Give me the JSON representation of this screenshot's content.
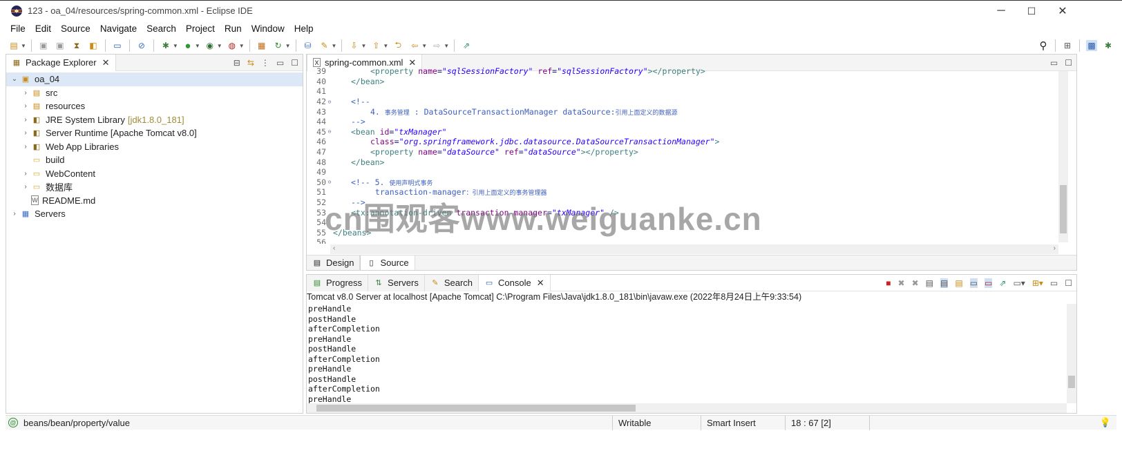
{
  "window": {
    "title": "123 - oa_04/resources/spring-common.xml - Eclipse IDE",
    "minimize": "─",
    "maximize": "☐",
    "close": "✕"
  },
  "menu": [
    "File",
    "Edit",
    "Source",
    "Navigate",
    "Search",
    "Project",
    "Run",
    "Window",
    "Help"
  ],
  "package_explorer": {
    "tab_label": "Package Explorer",
    "tree": [
      {
        "label": "oa_04",
        "suffix": "",
        "level": 0,
        "expanded": true,
        "icon": "project-icon",
        "selected": true
      },
      {
        "label": "src",
        "suffix": "",
        "level": 1,
        "expanded": false,
        "icon": "source-folder-icon"
      },
      {
        "label": "resources",
        "suffix": "",
        "level": 1,
        "expanded": false,
        "icon": "source-folder-icon"
      },
      {
        "label": "JRE System Library",
        "suffix": "[jdk1.8.0_181]",
        "level": 1,
        "expanded": false,
        "icon": "library-icon"
      },
      {
        "label": "Server Runtime [Apache Tomcat v8.0]",
        "suffix": "",
        "level": 1,
        "expanded": false,
        "icon": "library-icon"
      },
      {
        "label": "Web App Libraries",
        "suffix": "",
        "level": 1,
        "expanded": false,
        "icon": "library-icon"
      },
      {
        "label": "build",
        "suffix": "",
        "level": 1,
        "expanded": null,
        "icon": "folder-icon"
      },
      {
        "label": "WebContent",
        "suffix": "",
        "level": 1,
        "expanded": false,
        "icon": "folder-icon"
      },
      {
        "label": "数据库",
        "suffix": "",
        "level": 1,
        "expanded": false,
        "icon": "folder-icon"
      },
      {
        "label": "README.md",
        "suffix": "",
        "level": 1,
        "expanded": null,
        "icon": "file-icon"
      },
      {
        "label": "Servers",
        "suffix": "",
        "level": 0,
        "expanded": false,
        "icon": "servers-project-icon"
      }
    ]
  },
  "editor": {
    "tab_label": "spring-common.xml",
    "bottom_tabs": [
      "Design",
      "Source"
    ],
    "lines": [
      {
        "n": "39",
        "fold": "",
        "html": "<span class='tag'>&lt;property</span> <span class='attr'>name</span>=<span class='val'>\"sqlSessionFactory\"</span> <span class='attr'>ref</span>=<span class='val'>\"sqlSessionFactory\"</span><span class='tag'>&gt;&lt;/property&gt;</span>",
        "indent": 2
      },
      {
        "n": "40",
        "fold": "",
        "html": "<span class='tag'>&lt;/bean&gt;</span>",
        "indent": 1
      },
      {
        "n": "41",
        "fold": "",
        "html": "",
        "indent": 1
      },
      {
        "n": "42",
        "fold": "⊖",
        "html": "<span class='cmt'>&lt;!--</span>",
        "indent": 1
      },
      {
        "n": "43",
        "fold": "",
        "html": "<span class='cmt'>4. <span class='cjk'>事务管理</span> : DataSourceTransactionManager dataSource:<span class='cjk'>引用上面定义的数据源</span></span>",
        "indent": 2
      },
      {
        "n": "44",
        "fold": "",
        "html": "<span class='cmt'>--&gt;</span>",
        "indent": 1
      },
      {
        "n": "45",
        "fold": "⊖",
        "html": "<span class='tag'>&lt;bean</span> <span class='attr'>id</span>=<span class='val'>\"txManager\"</span>",
        "indent": 1
      },
      {
        "n": "46",
        "fold": "",
        "html": "<span class='attr'>class</span>=<span class='val'>\"org.springframework.jdbc.datasource.DataSourceTransactionManager\"</span><span class='tag'>&gt;</span>",
        "indent": 2
      },
      {
        "n": "47",
        "fold": "",
        "html": "<span class='tag'>&lt;property</span> <span class='attr'>name</span>=<span class='val'>\"dataSource\"</span> <span class='attr'>ref</span>=<span class='val'>\"dataSource\"</span><span class='tag'>&gt;&lt;/property&gt;</span>",
        "indent": 2
      },
      {
        "n": "48",
        "fold": "",
        "html": "<span class='tag'>&lt;/bean&gt;</span>",
        "indent": 1
      },
      {
        "n": "49",
        "fold": "",
        "html": "",
        "indent": 1
      },
      {
        "n": "50",
        "fold": "⊖",
        "html": "<span class='cmt'>&lt;!-- 5. <span class='cjk'>使用声明式事务</span></span>",
        "indent": 1
      },
      {
        "n": "51",
        "fold": "",
        "html": "<span class='cmt'> transaction-manager<span class='cjk'>：引用上面定义的事务管理器</span></span>",
        "indent": 2
      },
      {
        "n": "52",
        "fold": "",
        "html": "<span class='cmt'>--&gt;</span>",
        "indent": 1
      },
      {
        "n": "53",
        "fold": "",
        "html": "<span class='tag'>&lt;tx:annotation-driven</span> <span class='attr'>transaction-manager</span>=<span class='val'>\"txManager\"</span> <span class='tag'>/&gt;</span>",
        "indent": 1
      },
      {
        "n": "54",
        "fold": "",
        "html": "",
        "indent": 1
      },
      {
        "n": "55",
        "fold": "",
        "html": "<span class='tag'>&lt;/beans&gt;</span>",
        "indent": 0
      },
      {
        "n": "56",
        "fold": "",
        "html": "",
        "indent": 0
      }
    ]
  },
  "watermark": "cn围观客www.weiguanke.cn",
  "console_view": {
    "tabs": [
      "Progress",
      "Servers",
      "Search",
      "Console"
    ],
    "header": "Tomcat v8.0 Server at localhost [Apache Tomcat] C:\\Program Files\\Java\\jdk1.8.0_181\\bin\\javaw.exe  (2022年8月24日上午9:33:54)",
    "lines": [
      "preHandle",
      "postHandle",
      "afterCompletion",
      "preHandle",
      "postHandle",
      "afterCompletion",
      "preHandle",
      "postHandle",
      "afterCompletion",
      "preHandle"
    ]
  },
  "status": {
    "path": "beans/bean/property/value",
    "writable": "Writable",
    "insert_mode": "Smart Insert",
    "position": "18 : 67 [2]"
  },
  "colors": {
    "tag": "#3f7f7f",
    "attr": "#7f007f",
    "value": "#2a00ff",
    "comment": "#3f5fbf"
  }
}
